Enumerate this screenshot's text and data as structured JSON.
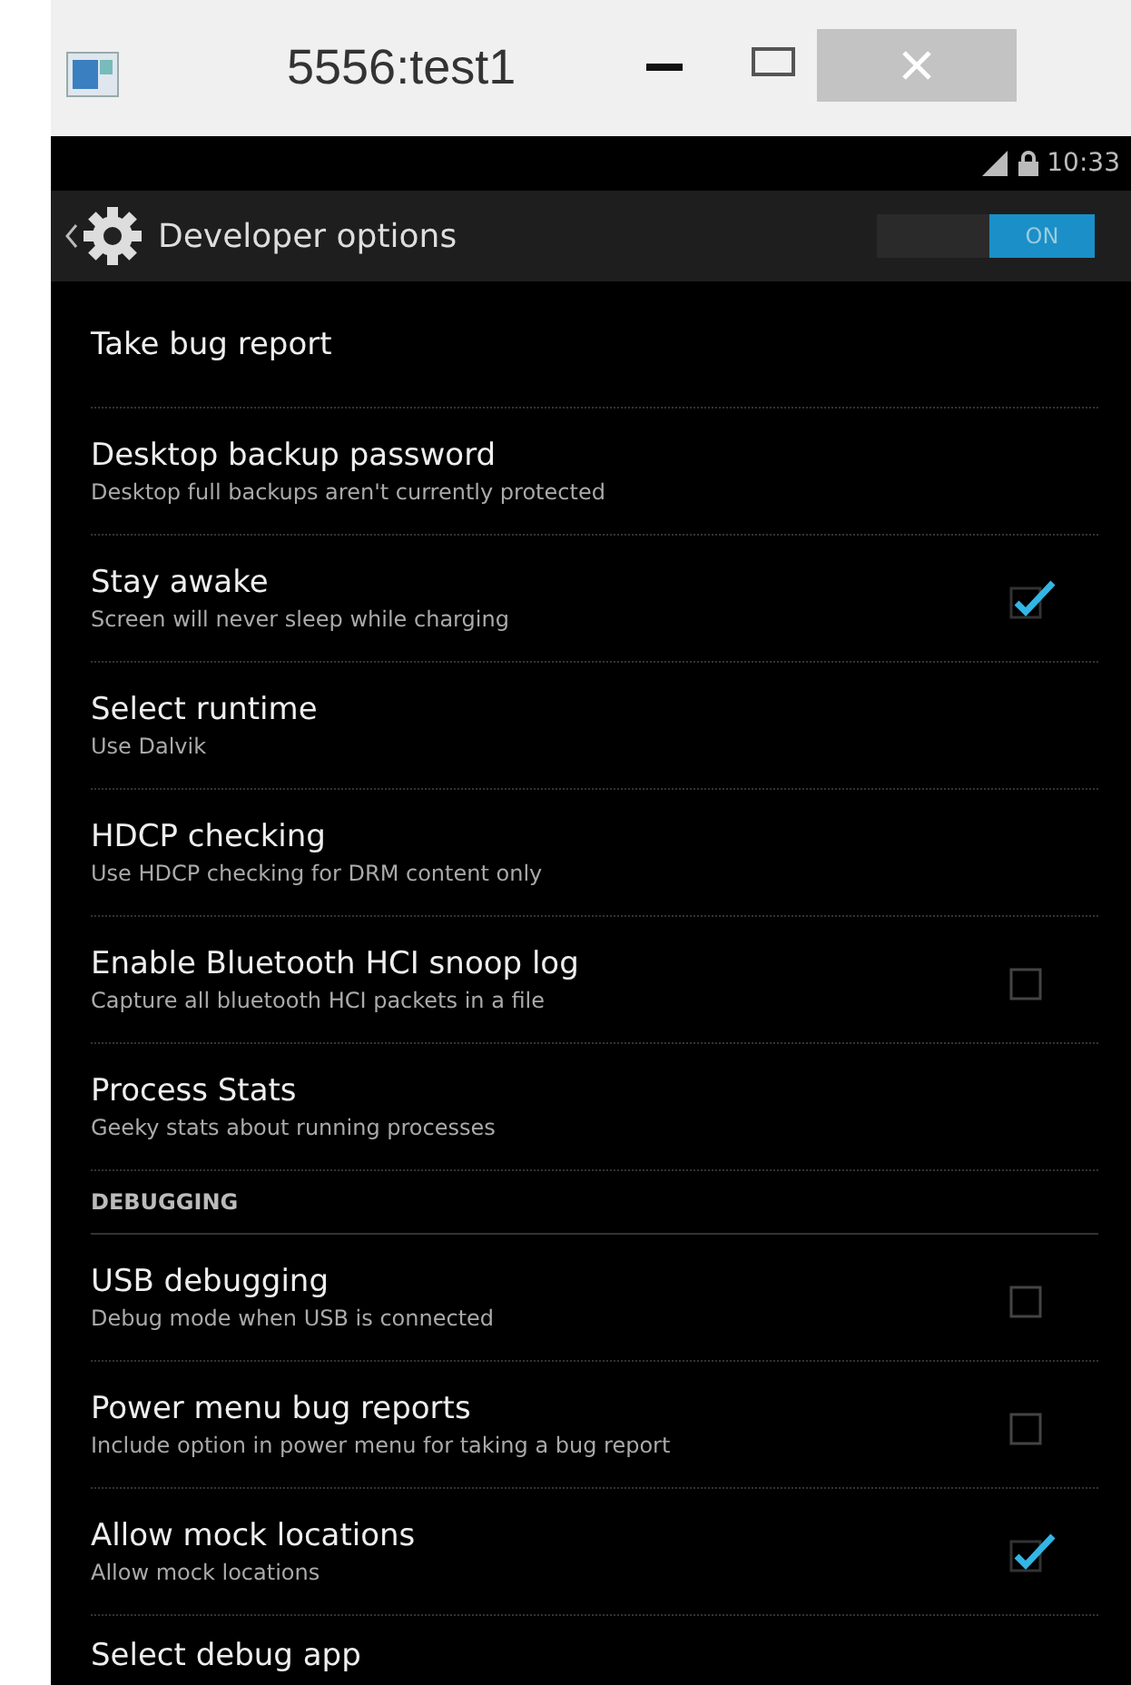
{
  "window": {
    "title": "5556:test1"
  },
  "status_bar": {
    "time": "10:33"
  },
  "action_bar": {
    "title": "Developer options",
    "switch": {
      "on": true,
      "label": "ON"
    }
  },
  "items": [
    {
      "kind": "plain",
      "title": "Take bug report"
    },
    {
      "kind": "plain",
      "title": "Desktop backup password",
      "summary": "Desktop full backups aren't currently protected"
    },
    {
      "kind": "checkbox",
      "title": "Stay awake",
      "summary": "Screen will never sleep while charging",
      "checked": true
    },
    {
      "kind": "plain",
      "title": "Select runtime",
      "summary": "Use Dalvik"
    },
    {
      "kind": "plain",
      "title": "HDCP checking",
      "summary": "Use HDCP checking for DRM content only"
    },
    {
      "kind": "checkbox",
      "title": "Enable Bluetooth HCI snoop log",
      "summary": "Capture all bluetooth HCI packets in a file",
      "checked": false
    },
    {
      "kind": "plain",
      "title": "Process Stats",
      "summary": "Geeky stats about running processes"
    },
    {
      "kind": "header",
      "title": "DEBUGGING"
    },
    {
      "kind": "checkbox",
      "title": "USB debugging",
      "summary": "Debug mode when USB is connected",
      "checked": false
    },
    {
      "kind": "checkbox",
      "title": "Power menu bug reports",
      "summary": "Include option in power menu for taking a bug report",
      "checked": false
    },
    {
      "kind": "checkbox",
      "title": "Allow mock locations",
      "summary": "Allow mock locations",
      "checked": true
    },
    {
      "kind": "plain",
      "title": "Select debug app"
    }
  ]
}
